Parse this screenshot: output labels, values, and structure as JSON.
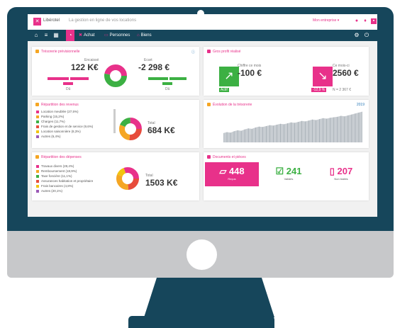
{
  "header": {
    "app_name": "Libérotel",
    "title": "La gestion en ligne de vos locations",
    "company": "Mon entreprise ▾"
  },
  "nav": {
    "items": [
      {
        "label": "Achat"
      },
      {
        "label": "Personnes"
      },
      {
        "label": "Biens"
      }
    ]
  },
  "cards": {
    "treasury": {
      "title": "Trésorerie prévisionnelle",
      "left_caption": "Encaissé",
      "left_value": "122 K€",
      "right_caption": "Ecart",
      "right_value": "-2 298 €",
      "bottom_left": "Dû",
      "bottom_right": "Dû"
    },
    "result": {
      "title": "Gros profit réalisé",
      "left_caption": "Chiffre ce mois",
      "left_value": "-100 €",
      "left_badge": "Actif",
      "right_caption": "Ce mois-ci",
      "right_value": "2560 €",
      "right_badge": "-12,9 %",
      "right_sub": "N = 2 367 €"
    },
    "revenue": {
      "title": "Répartition des revenus",
      "total_caption": "Total",
      "total_value": "684 K€",
      "legend": [
        {
          "label": "Location meublée (27,5%)",
          "color": "#e8318a"
        },
        {
          "label": "Parking (15,2%)",
          "color": "#f5a623"
        },
        {
          "label": "Charges (11,7%)",
          "color": "#3cb043"
        },
        {
          "label": "Frais de gestion et de service (9,6%)",
          "color": "#e74c3c"
        },
        {
          "label": "Location saisonnière (8,3%)",
          "color": "#f1c40f"
        },
        {
          "label": "Autres (6,4%)",
          "color": "#9b59b6"
        }
      ]
    },
    "trend": {
      "title": "Évolution de la trésorerie",
      "legend": "2019"
    },
    "expenses": {
      "title": "Répartition des dépenses",
      "total_caption": "Total",
      "total_value": "1503 K€",
      "legend": [
        {
          "label": "Travaux divers (28,4%)",
          "color": "#e8318a"
        },
        {
          "label": "Remboursement (18,9%)",
          "color": "#f5a623"
        },
        {
          "label": "Taxe foncière (11,1%)",
          "color": "#3cb043"
        },
        {
          "label": "Assurances habitation et propriétaire",
          "color": "#e74c3c"
        },
        {
          "label": "Frais bancaires (4,8%)",
          "color": "#f1c40f"
        },
        {
          "label": "Autres (20,1%)",
          "color": "#9b59b6"
        }
      ]
    },
    "docs": {
      "title": "Documents et pièces",
      "stats": [
        {
          "value": "448",
          "label": "Reçus"
        },
        {
          "value": "241",
          "label": "Validés"
        },
        {
          "value": "207",
          "label": "Non traités"
        }
      ]
    }
  },
  "chart_data": {
    "type": "area",
    "legend": [
      "2019"
    ],
    "y": [
      20,
      22,
      21,
      24,
      26,
      25,
      28,
      30,
      29,
      32,
      34,
      33,
      35,
      37,
      36,
      38,
      40,
      39,
      41,
      43,
      42,
      44,
      46,
      45,
      47,
      49,
      48,
      50,
      52,
      51,
      53,
      54,
      55,
      57,
      56,
      58,
      60,
      62,
      64,
      66
    ]
  },
  "colors": {
    "brand": "#e8318a",
    "nav": "#16465b",
    "positive": "#3cb043",
    "frame": "#16465b",
    "bezel": "#c7c8ca"
  }
}
